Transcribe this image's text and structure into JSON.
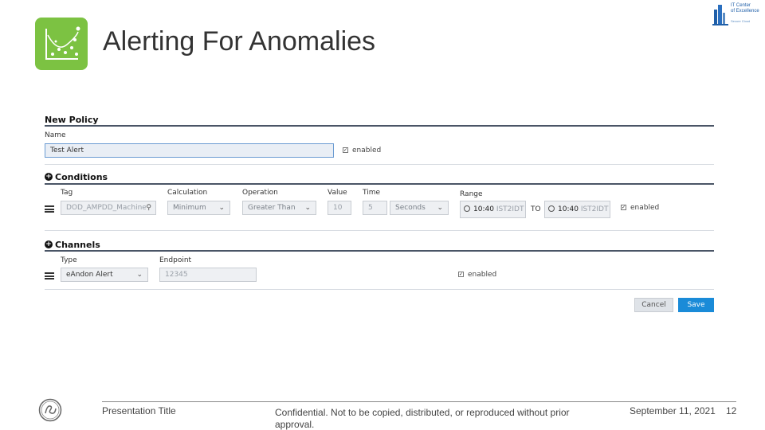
{
  "header": {
    "title": "Alerting For Anomalies",
    "logo_color": "#7cc242",
    "coe_lines": [
      "IT Center",
      "of Excellence"
    ],
    "coe_subtext": "Secure Cloud"
  },
  "form": {
    "new_policy": {
      "heading": "New Policy",
      "name_label": "Name",
      "name_value": "Test Alert",
      "enabled_label": "enabled",
      "enabled_checked": true
    },
    "conditions": {
      "heading": "Conditions",
      "labels": {
        "tag": "Tag",
        "calculation": "Calculation",
        "operation": "Operation",
        "value": "Value",
        "time": "Time",
        "range": "Range"
      },
      "row": {
        "tag": "DOD_AMPDD_Machine",
        "calculation": "Minimum",
        "operation": "Greater Than",
        "value": "10",
        "time_value": "5",
        "time_unit": "Seconds",
        "range_start_time": "10:40",
        "range_start_tz": "IST2IDT",
        "to_label": "TO",
        "range_end_time": "10:40",
        "range_end_tz": "IST2IDT",
        "enabled_label": "enabled",
        "enabled_checked": true
      }
    },
    "channels": {
      "heading": "Channels",
      "labels": {
        "type": "Type",
        "endpoint": "Endpoint"
      },
      "row": {
        "type": "eAndon Alert",
        "endpoint": "12345",
        "enabled_label": "enabled",
        "enabled_checked": true
      }
    },
    "buttons": {
      "cancel": "Cancel",
      "save": "Save"
    },
    "accent_color": "#1a8bd8"
  },
  "footer": {
    "presentation_title": "Presentation Title",
    "confidential": "Confidential. Not to be copied, distributed, or reproduced without prior approval.",
    "date": "September 11, 2021",
    "page_number": "12"
  }
}
